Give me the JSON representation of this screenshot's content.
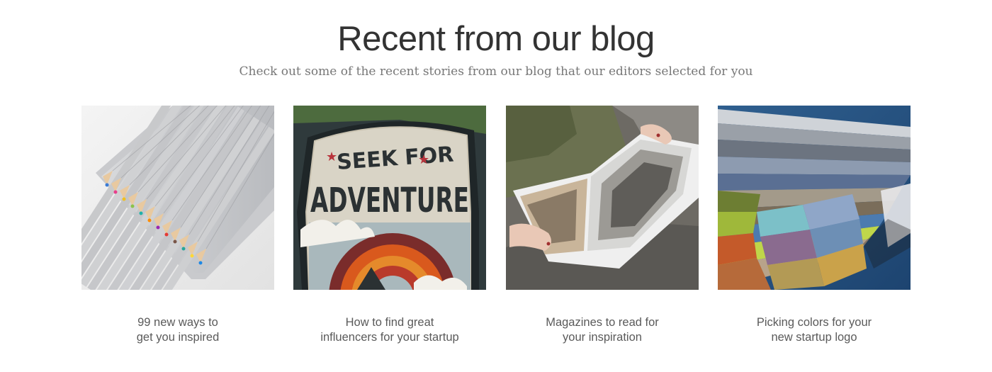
{
  "header": {
    "title": "Recent from our blog",
    "subtitle": "Check out some of the recent stories from our blog that our editors selected for you"
  },
  "posts": [
    {
      "image": "colored-pencils-photo",
      "title_lines": [
        "99 new ways to",
        "get you inspired"
      ]
    },
    {
      "image": "seek-for-adventure-patch-photo",
      "image_text": [
        "SEEK FOR",
        "ADVENTURE"
      ],
      "title_lines": [
        "How to find great",
        "influencers for your startup"
      ]
    },
    {
      "image": "reading-magazine-photo",
      "title_lines": [
        "Magazines to read for",
        "your inspiration"
      ]
    },
    {
      "image": "color-swatch-fan-photo",
      "title_lines": [
        "Picking colors for your",
        "new startup logo"
      ]
    }
  ],
  "colors": {
    "title": "#333333",
    "subtitle": "#777777",
    "card_title": "#5a5a5a"
  }
}
